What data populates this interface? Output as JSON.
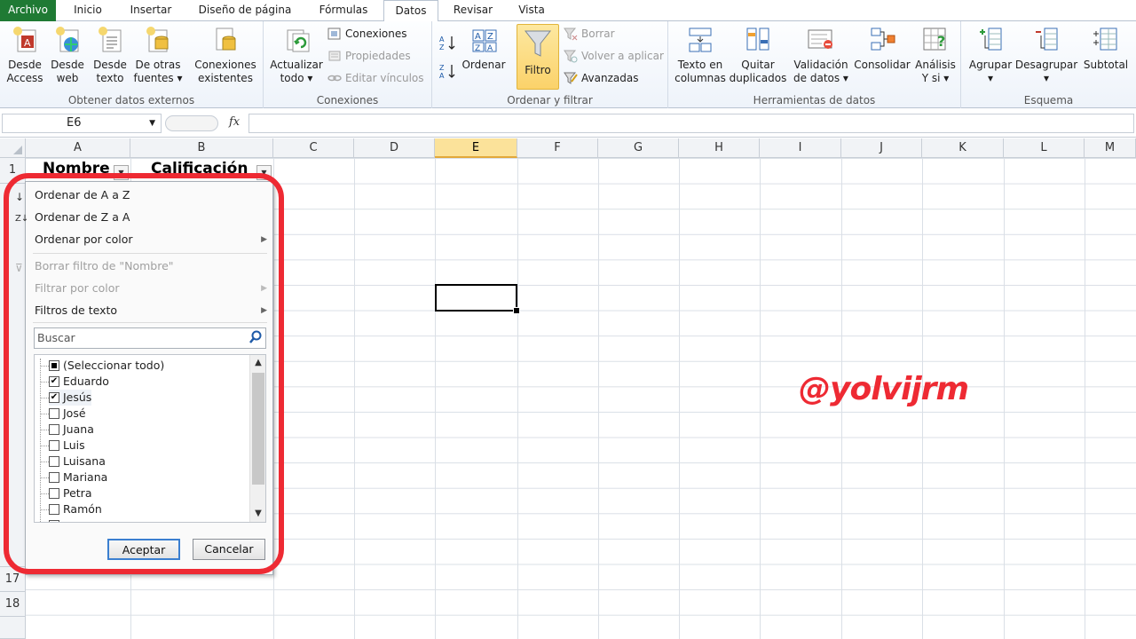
{
  "tabs": [
    "Archivo",
    "Inicio",
    "Insertar",
    "Diseño de página",
    "Fórmulas",
    "Datos",
    "Revisar",
    "Vista"
  ],
  "active_tab": "Datos",
  "ribbon": {
    "groups": {
      "obtener": "Obtener datos externos",
      "conexiones": "Conexiones",
      "ordenar": "Ordenar y filtrar",
      "herramientas": "Herramientas de datos",
      "esquema": "Esquema"
    },
    "desde_access": [
      "Desde",
      "Access"
    ],
    "desde_web": [
      "Desde",
      "web"
    ],
    "desde_texto": [
      "Desde",
      "texto"
    ],
    "otras_fuentes": [
      "De otras",
      "fuentes ▾"
    ],
    "conexiones_existentes": [
      "Conexiones",
      "existentes"
    ],
    "actualizar": [
      "Actualizar",
      "todo ▾"
    ],
    "conexiones_small": "Conexiones",
    "propiedades": "Propiedades",
    "editar_vinculos": "Editar vínculos",
    "ordenar": "Ordenar",
    "filtro": "Filtro",
    "borrar": "Borrar",
    "volver_aplicar": "Volver a aplicar",
    "avanzadas": "Avanzadas",
    "texto_columnas": [
      "Texto en",
      "columnas"
    ],
    "quitar_duplicados": [
      "Quitar",
      "duplicados"
    ],
    "validacion": [
      "Validación",
      "de datos ▾"
    ],
    "consolidar": [
      "Consolidar",
      ""
    ],
    "analisis": [
      "Análisis",
      "Y si ▾"
    ],
    "agrupar": [
      "Agrupar",
      "▾"
    ],
    "desagrupar": [
      "Desagrupar",
      "▾"
    ],
    "subtotal": [
      "Subtotal",
      ""
    ]
  },
  "formula_bar": {
    "name_box": "E6",
    "fx": "fx",
    "formula": ""
  },
  "columns": [
    "A",
    "B",
    "C",
    "D",
    "E",
    "F",
    "G",
    "H",
    "I",
    "J",
    "K",
    "L",
    "M"
  ],
  "selected_column": "E",
  "rows_visible": [
    "1",
    "17",
    "18"
  ],
  "cells": {
    "A1": "Nombre",
    "B1": "Calificación"
  },
  "filter_menu": {
    "sort_az": "Ordenar de A a Z",
    "sort_za": "Ordenar de Z a A",
    "sort_color": "Ordenar por color",
    "clear_filter": "Borrar filtro de \"Nombre\"",
    "filter_color": "Filtrar por color",
    "text_filters": "Filtros de texto",
    "search_placeholder": "Buscar",
    "items": [
      {
        "label": "(Seleccionar todo)",
        "state": "partial"
      },
      {
        "label": "Eduardo",
        "state": "checked"
      },
      {
        "label": "Jesús",
        "state": "checked"
      },
      {
        "label": "José",
        "state": "unchecked"
      },
      {
        "label": "Juana",
        "state": "unchecked"
      },
      {
        "label": "Luis",
        "state": "unchecked"
      },
      {
        "label": "Luisana",
        "state": "unchecked"
      },
      {
        "label": "Mariana",
        "state": "unchecked"
      },
      {
        "label": "Petra",
        "state": "unchecked"
      },
      {
        "label": "Ramón",
        "state": "unchecked"
      }
    ],
    "ok": "Aceptar",
    "cancel": "Cancelar"
  },
  "watermark": "@yolvijrm",
  "colors": {
    "file_tab": "#1f7a34",
    "highlight": "#ee2a33",
    "filter_active": "#fbd26a"
  }
}
